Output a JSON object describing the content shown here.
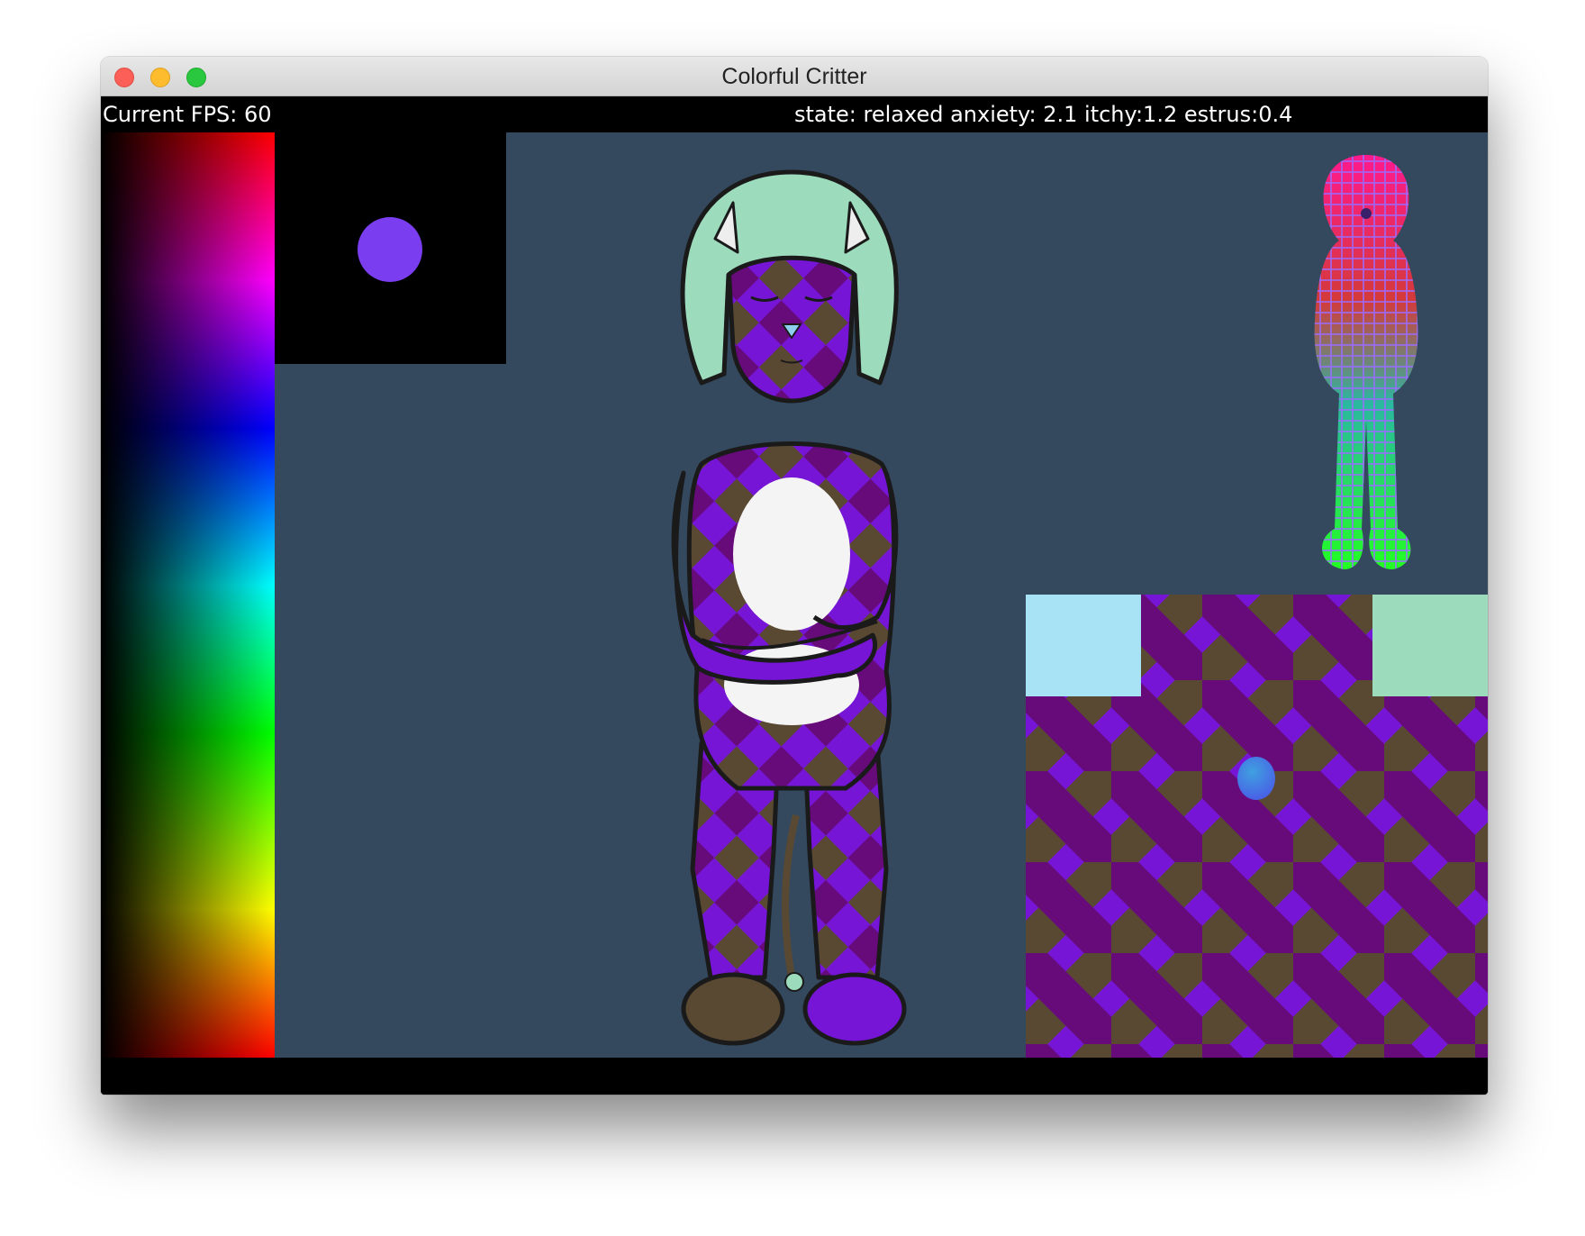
{
  "window": {
    "title": "Colorful Critter"
  },
  "hud": {
    "fps_text": "Current FPS: 60",
    "state_text": "state: relaxed anxiety: 2.1 itchy:1.2 estrus:0.4"
  },
  "colors": {
    "scene_background": "#34495e",
    "critter_purple": "#7615d5",
    "critter_dark_purple": "#670a7a",
    "critter_brown": "#5a4932",
    "hair": "#9ddbbd",
    "brush_color": "#7a3df0",
    "left_swatch": "#a8e2f5",
    "right_swatch": "#9ddbbd"
  },
  "icons": {
    "close": "close-traffic-light",
    "minimize": "minimize-traffic-light",
    "maximize": "maximize-traffic-light"
  }
}
